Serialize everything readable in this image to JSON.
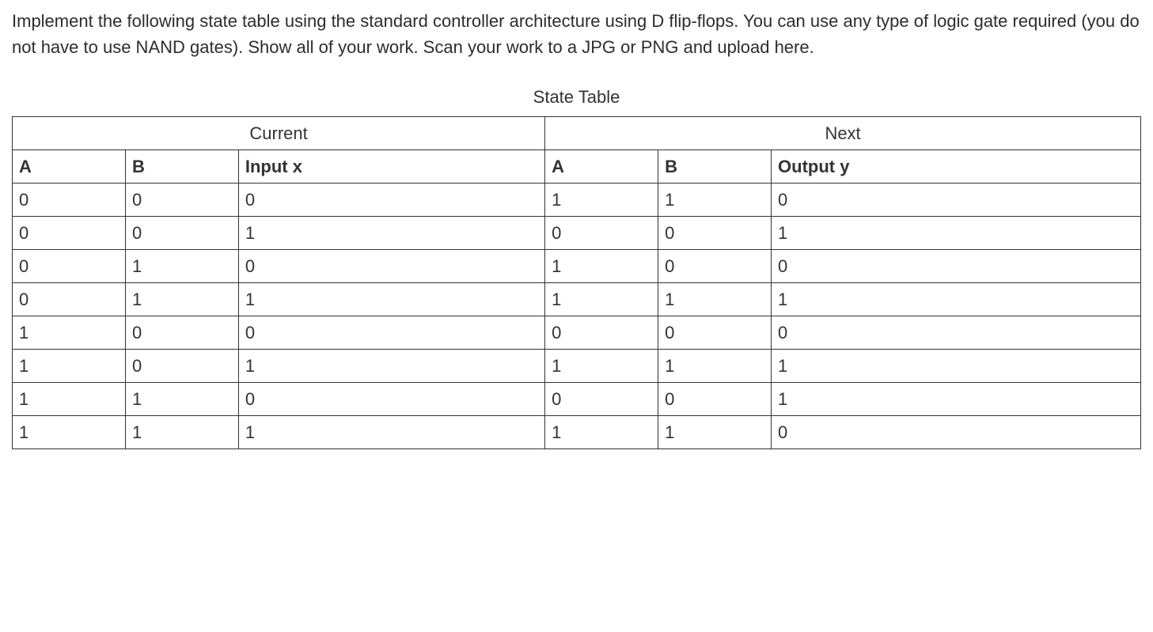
{
  "instructions": "Implement the following state table using the standard controller architecture using D flip-flops. You can use any type of logic gate required (you do not have to use NAND gates). Show all of your work. Scan your work to a JPG or PNG and upload here.",
  "table_title": "State Table",
  "group_headers": {
    "current": "Current",
    "next": "Next"
  },
  "columns": {
    "col0": "A",
    "col1": "B",
    "col2": "Input x",
    "col3": "A",
    "col4": "B",
    "col5": "Output y"
  },
  "rows": [
    {
      "c0": "0",
      "c1": "0",
      "c2": "0",
      "c3": "1",
      "c4": "1",
      "c5": "0"
    },
    {
      "c0": "0",
      "c1": "0",
      "c2": "1",
      "c3": "0",
      "c4": "0",
      "c5": "1"
    },
    {
      "c0": "0",
      "c1": "1",
      "c2": "0",
      "c3": "1",
      "c4": "0",
      "c5": "0"
    },
    {
      "c0": "0",
      "c1": "1",
      "c2": "1",
      "c3": "1",
      "c4": "1",
      "c5": "1"
    },
    {
      "c0": "1",
      "c1": "0",
      "c2": "0",
      "c3": "0",
      "c4": "0",
      "c5": "0"
    },
    {
      "c0": "1",
      "c1": "0",
      "c2": "1",
      "c3": "1",
      "c4": "1",
      "c5": "1"
    },
    {
      "c0": "1",
      "c1": "1",
      "c2": "0",
      "c3": "0",
      "c4": "0",
      "c5": "1"
    },
    {
      "c0": "1",
      "c1": "1",
      "c2": "1",
      "c3": "1",
      "c4": "1",
      "c5": "0"
    }
  ]
}
